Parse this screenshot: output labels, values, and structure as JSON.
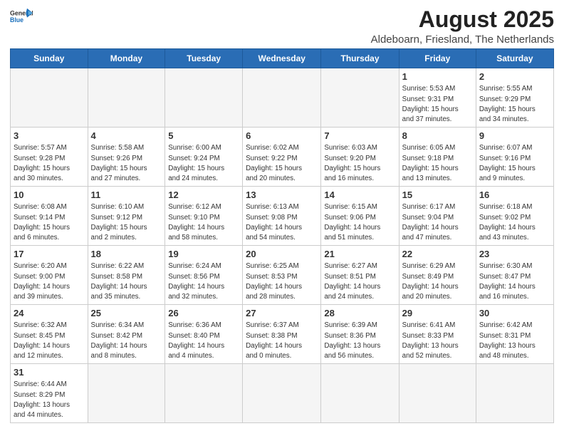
{
  "logo": {
    "text_general": "General",
    "text_blue": "Blue"
  },
  "title": "August 2025",
  "subtitle": "Aldeboarn, Friesland, The Netherlands",
  "days_of_week": [
    "Sunday",
    "Monday",
    "Tuesday",
    "Wednesday",
    "Thursday",
    "Friday",
    "Saturday"
  ],
  "weeks": [
    [
      {
        "day": "",
        "info": "",
        "empty": true
      },
      {
        "day": "",
        "info": "",
        "empty": true
      },
      {
        "day": "",
        "info": "",
        "empty": true
      },
      {
        "day": "",
        "info": "",
        "empty": true
      },
      {
        "day": "",
        "info": "",
        "empty": true
      },
      {
        "day": "1",
        "info": "Sunrise: 5:53 AM\nSunset: 9:31 PM\nDaylight: 15 hours\nand 37 minutes."
      },
      {
        "day": "2",
        "info": "Sunrise: 5:55 AM\nSunset: 9:29 PM\nDaylight: 15 hours\nand 34 minutes."
      }
    ],
    [
      {
        "day": "3",
        "info": "Sunrise: 5:57 AM\nSunset: 9:28 PM\nDaylight: 15 hours\nand 30 minutes."
      },
      {
        "day": "4",
        "info": "Sunrise: 5:58 AM\nSunset: 9:26 PM\nDaylight: 15 hours\nand 27 minutes."
      },
      {
        "day": "5",
        "info": "Sunrise: 6:00 AM\nSunset: 9:24 PM\nDaylight: 15 hours\nand 24 minutes."
      },
      {
        "day": "6",
        "info": "Sunrise: 6:02 AM\nSunset: 9:22 PM\nDaylight: 15 hours\nand 20 minutes."
      },
      {
        "day": "7",
        "info": "Sunrise: 6:03 AM\nSunset: 9:20 PM\nDaylight: 15 hours\nand 16 minutes."
      },
      {
        "day": "8",
        "info": "Sunrise: 6:05 AM\nSunset: 9:18 PM\nDaylight: 15 hours\nand 13 minutes."
      },
      {
        "day": "9",
        "info": "Sunrise: 6:07 AM\nSunset: 9:16 PM\nDaylight: 15 hours\nand 9 minutes."
      }
    ],
    [
      {
        "day": "10",
        "info": "Sunrise: 6:08 AM\nSunset: 9:14 PM\nDaylight: 15 hours\nand 6 minutes."
      },
      {
        "day": "11",
        "info": "Sunrise: 6:10 AM\nSunset: 9:12 PM\nDaylight: 15 hours\nand 2 minutes."
      },
      {
        "day": "12",
        "info": "Sunrise: 6:12 AM\nSunset: 9:10 PM\nDaylight: 14 hours\nand 58 minutes."
      },
      {
        "day": "13",
        "info": "Sunrise: 6:13 AM\nSunset: 9:08 PM\nDaylight: 14 hours\nand 54 minutes."
      },
      {
        "day": "14",
        "info": "Sunrise: 6:15 AM\nSunset: 9:06 PM\nDaylight: 14 hours\nand 51 minutes."
      },
      {
        "day": "15",
        "info": "Sunrise: 6:17 AM\nSunset: 9:04 PM\nDaylight: 14 hours\nand 47 minutes."
      },
      {
        "day": "16",
        "info": "Sunrise: 6:18 AM\nSunset: 9:02 PM\nDaylight: 14 hours\nand 43 minutes."
      }
    ],
    [
      {
        "day": "17",
        "info": "Sunrise: 6:20 AM\nSunset: 9:00 PM\nDaylight: 14 hours\nand 39 minutes."
      },
      {
        "day": "18",
        "info": "Sunrise: 6:22 AM\nSunset: 8:58 PM\nDaylight: 14 hours\nand 35 minutes."
      },
      {
        "day": "19",
        "info": "Sunrise: 6:24 AM\nSunset: 8:56 PM\nDaylight: 14 hours\nand 32 minutes."
      },
      {
        "day": "20",
        "info": "Sunrise: 6:25 AM\nSunset: 8:53 PM\nDaylight: 14 hours\nand 28 minutes."
      },
      {
        "day": "21",
        "info": "Sunrise: 6:27 AM\nSunset: 8:51 PM\nDaylight: 14 hours\nand 24 minutes."
      },
      {
        "day": "22",
        "info": "Sunrise: 6:29 AM\nSunset: 8:49 PM\nDaylight: 14 hours\nand 20 minutes."
      },
      {
        "day": "23",
        "info": "Sunrise: 6:30 AM\nSunset: 8:47 PM\nDaylight: 14 hours\nand 16 minutes."
      }
    ],
    [
      {
        "day": "24",
        "info": "Sunrise: 6:32 AM\nSunset: 8:45 PM\nDaylight: 14 hours\nand 12 minutes."
      },
      {
        "day": "25",
        "info": "Sunrise: 6:34 AM\nSunset: 8:42 PM\nDaylight: 14 hours\nand 8 minutes."
      },
      {
        "day": "26",
        "info": "Sunrise: 6:36 AM\nSunset: 8:40 PM\nDaylight: 14 hours\nand 4 minutes."
      },
      {
        "day": "27",
        "info": "Sunrise: 6:37 AM\nSunset: 8:38 PM\nDaylight: 14 hours\nand 0 minutes."
      },
      {
        "day": "28",
        "info": "Sunrise: 6:39 AM\nSunset: 8:36 PM\nDaylight: 13 hours\nand 56 minutes."
      },
      {
        "day": "29",
        "info": "Sunrise: 6:41 AM\nSunset: 8:33 PM\nDaylight: 13 hours\nand 52 minutes."
      },
      {
        "day": "30",
        "info": "Sunrise: 6:42 AM\nSunset: 8:31 PM\nDaylight: 13 hours\nand 48 minutes."
      }
    ],
    [
      {
        "day": "31",
        "info": "Sunrise: 6:44 AM\nSunset: 8:29 PM\nDaylight: 13 hours\nand 44 minutes."
      },
      {
        "day": "",
        "info": "",
        "empty": true
      },
      {
        "day": "",
        "info": "",
        "empty": true
      },
      {
        "day": "",
        "info": "",
        "empty": true
      },
      {
        "day": "",
        "info": "",
        "empty": true
      },
      {
        "day": "",
        "info": "",
        "empty": true
      },
      {
        "day": "",
        "info": "",
        "empty": true
      }
    ]
  ]
}
